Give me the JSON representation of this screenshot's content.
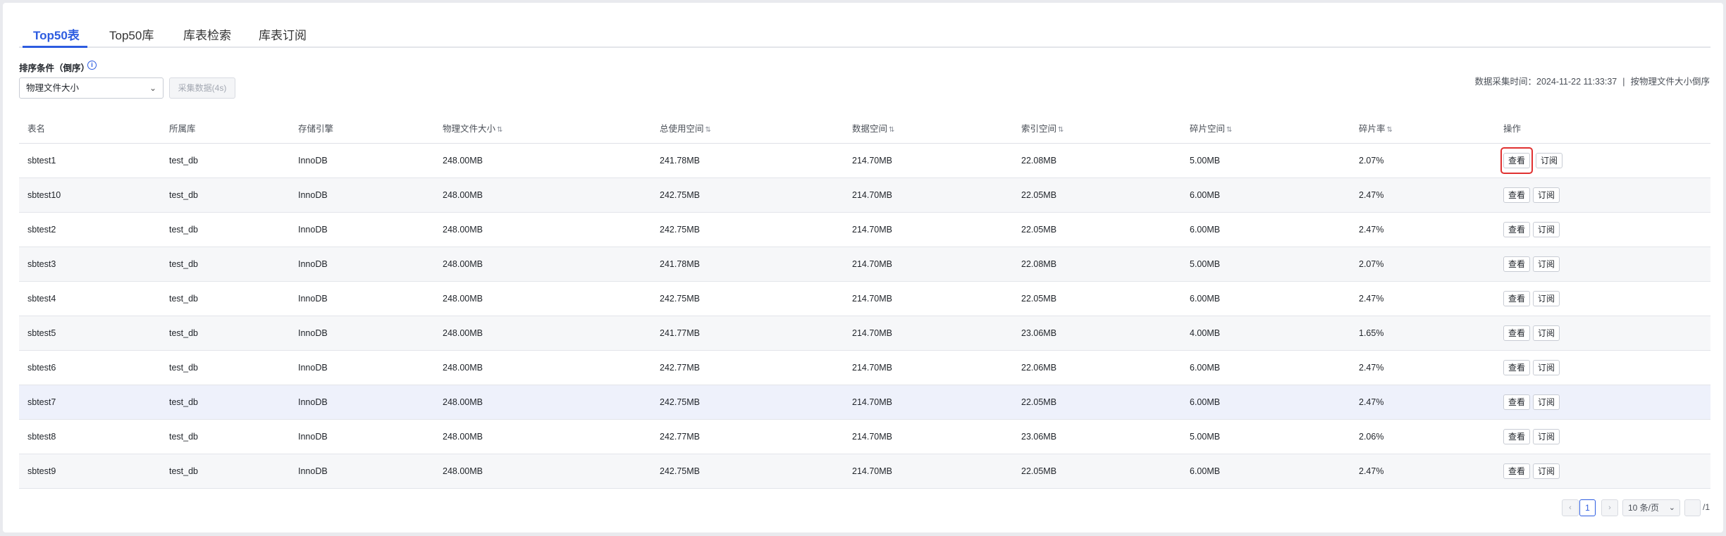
{
  "tabs": [
    {
      "label": "Top50表",
      "active": true
    },
    {
      "label": "Top50库",
      "active": false
    },
    {
      "label": "库表检索",
      "active": false
    },
    {
      "label": "库表订阅",
      "active": false
    }
  ],
  "filter": {
    "sort_label": "排序条件（倒序）",
    "info_icon": "info-icon",
    "select_value": "物理文件大小",
    "collect_button": "采集数据(4s)"
  },
  "meta": {
    "collect_time": "数据采集时间：2024-11-22 11:33:37",
    "separator": "|",
    "sort_desc": "按物理文件大小倒序"
  },
  "table": {
    "headers": [
      "表名",
      "所属库",
      "存储引擎",
      "物理文件大小",
      "总使用空间",
      "数据空间",
      "索引空间",
      "碎片空间",
      "碎片率",
      "操作"
    ],
    "sortable": [
      false,
      false,
      false,
      true,
      true,
      true,
      true,
      true,
      true,
      false
    ],
    "sort_icon": "⇅",
    "rows": [
      {
        "name": "sbtest1",
        "db": "test_db",
        "engine": "InnoDB",
        "phys": "248.00MB",
        "total": "241.78MB",
        "data": "214.70MB",
        "index": "22.08MB",
        "frag": "5.00MB",
        "rate": "2.07%"
      },
      {
        "name": "sbtest10",
        "db": "test_db",
        "engine": "InnoDB",
        "phys": "248.00MB",
        "total": "242.75MB",
        "data": "214.70MB",
        "index": "22.05MB",
        "frag": "6.00MB",
        "rate": "2.47%"
      },
      {
        "name": "sbtest2",
        "db": "test_db",
        "engine": "InnoDB",
        "phys": "248.00MB",
        "total": "242.75MB",
        "data": "214.70MB",
        "index": "22.05MB",
        "frag": "6.00MB",
        "rate": "2.47%"
      },
      {
        "name": "sbtest3",
        "db": "test_db",
        "engine": "InnoDB",
        "phys": "248.00MB",
        "total": "241.78MB",
        "data": "214.70MB",
        "index": "22.08MB",
        "frag": "5.00MB",
        "rate": "2.07%"
      },
      {
        "name": "sbtest4",
        "db": "test_db",
        "engine": "InnoDB",
        "phys": "248.00MB",
        "total": "242.75MB",
        "data": "214.70MB",
        "index": "22.05MB",
        "frag": "6.00MB",
        "rate": "2.47%"
      },
      {
        "name": "sbtest5",
        "db": "test_db",
        "engine": "InnoDB",
        "phys": "248.00MB",
        "total": "241.77MB",
        "data": "214.70MB",
        "index": "23.06MB",
        "frag": "4.00MB",
        "rate": "1.65%"
      },
      {
        "name": "sbtest6",
        "db": "test_db",
        "engine": "InnoDB",
        "phys": "248.00MB",
        "total": "242.77MB",
        "data": "214.70MB",
        "index": "22.06MB",
        "frag": "6.00MB",
        "rate": "2.47%"
      },
      {
        "name": "sbtest7",
        "db": "test_db",
        "engine": "InnoDB",
        "phys": "248.00MB",
        "total": "242.75MB",
        "data": "214.70MB",
        "index": "22.05MB",
        "frag": "6.00MB",
        "rate": "2.47%"
      },
      {
        "name": "sbtest8",
        "db": "test_db",
        "engine": "InnoDB",
        "phys": "248.00MB",
        "total": "242.77MB",
        "data": "214.70MB",
        "index": "23.06MB",
        "frag": "5.00MB",
        "rate": "2.06%"
      },
      {
        "name": "sbtest9",
        "db": "test_db",
        "engine": "InnoDB",
        "phys": "248.00MB",
        "total": "242.75MB",
        "data": "214.70MB",
        "index": "22.05MB",
        "frag": "6.00MB",
        "rate": "2.47%"
      }
    ],
    "view_label": "查看",
    "subscribe_label": "订阅"
  },
  "pagination": {
    "prev": "‹",
    "current": "1",
    "next": "›",
    "page_size": "10 条/页",
    "total_pages": "/1"
  },
  "colors": {
    "accent": "#2d5ce0",
    "highlight_box": "#e03131"
  }
}
